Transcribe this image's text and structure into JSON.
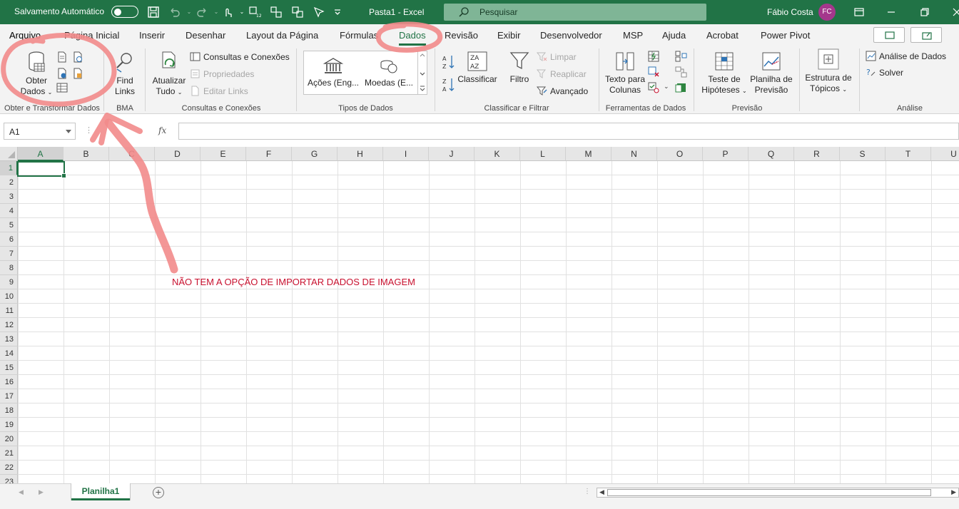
{
  "titlebar": {
    "autosave_label": "Salvamento Automático",
    "title": "Pasta1  -  Excel",
    "search_placeholder": "Pesquisar",
    "user_name": "Fábio Costa",
    "user_initials": "FC",
    "accent": "#217346"
  },
  "tabs": [
    "Arquivo",
    "Página Inicial",
    "Inserir",
    "Desenhar",
    "Layout da Página",
    "Fórmulas",
    "Dados",
    "Revisão",
    "Exibir",
    "Desenvolvedor",
    "MSP",
    "Ajuda",
    "Acrobat",
    "Power Pivot"
  ],
  "active_tab": "Dados",
  "ribbon": {
    "get_data": {
      "label_line1": "Obter",
      "label_line2": "Dados",
      "group_label": "Obter e Transformar Dados"
    },
    "bma": {
      "label_line1": "Find",
      "label_line2": "Links",
      "group_label": "BMA"
    },
    "queries": {
      "refresh_line1": "Atualizar",
      "refresh_line2": "Tudo",
      "connections": "Consultas e Conexões",
      "properties": "Propriedades",
      "edit_links": "Editar Links",
      "group_label": "Consultas e Conexões"
    },
    "data_types": {
      "stocks": "Ações (Eng...",
      "currencies": "Moedas (E...",
      "group_label": "Tipos de Dados"
    },
    "sort_filter": {
      "sort": "Classificar",
      "filter": "Filtro",
      "clear": "Limpar",
      "reapply": "Reaplicar",
      "advanced": "Avançado",
      "group_label": "Classificar e Filtrar"
    },
    "data_tools": {
      "text_to_cols_line1": "Texto para",
      "text_to_cols_line2": "Colunas",
      "group_label": "Ferramentas de Dados"
    },
    "forecast": {
      "whatif_line1": "Teste de",
      "whatif_line2": "Hipóteses",
      "sheet_line1": "Planilha de",
      "sheet_line2": "Previsão",
      "group_label": "Previsão"
    },
    "outline": {
      "line1": "Estrutura de",
      "line2": "Tópicos"
    },
    "analysis": {
      "data_analysis": "Análise de Dados",
      "solver": "Solver",
      "group_label": "Análise"
    }
  },
  "formula_bar": {
    "name_box": "A1",
    "fx": "fx",
    "value": ""
  },
  "grid": {
    "columns": [
      "A",
      "B",
      "C",
      "D",
      "E",
      "F",
      "G",
      "H",
      "I",
      "J",
      "K",
      "L",
      "M",
      "N",
      "O",
      "P",
      "Q",
      "R",
      "S",
      "T",
      "U"
    ],
    "rows": [
      "1",
      "2",
      "3",
      "4",
      "5",
      "6",
      "7",
      "8",
      "9",
      "10",
      "11",
      "12",
      "13",
      "14",
      "15",
      "16",
      "17",
      "18",
      "19",
      "20",
      "21",
      "22",
      "23"
    ],
    "selected_cell": "A1",
    "annotation": "NÃO TEM A OPÇÃO DE IMPORTAR DADOS DE IMAGEM",
    "annotation_color": "#c8102e"
  },
  "sheets": [
    "Planilha1"
  ]
}
